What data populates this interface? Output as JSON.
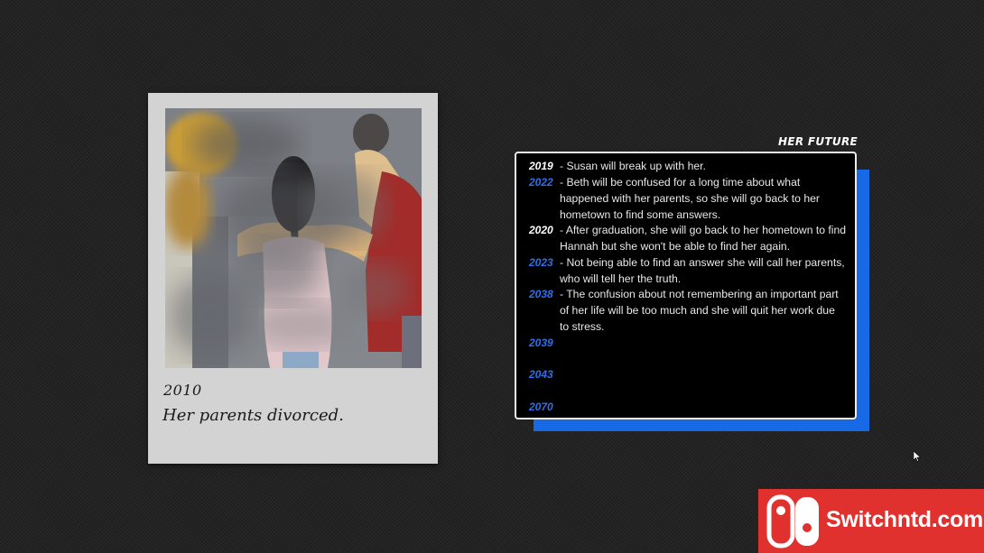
{
  "polaroid": {
    "year": "2010",
    "caption": "Her parents divorced."
  },
  "future": {
    "title": "HER FUTURE",
    "entries": [
      {
        "year": "2019",
        "year_color": "white",
        "text": "- Susan will break up with her."
      },
      {
        "year": "2022",
        "year_color": "blue",
        "text": "- Beth will be confused for a long time about what happened with her parents, so she will go back to her hometown to find some answers."
      },
      {
        "year": "2020",
        "year_color": "white",
        "text": "- After graduation, she will go back to her hometown to find Hannah but she won't be able to find her again."
      },
      {
        "year": "2023",
        "year_color": "blue",
        "text": "- Not being able to find an answer she will call her parents, who will tell her the truth."
      },
      {
        "year": "2038",
        "year_color": "blue",
        "text": "- The confusion about not remembering an important part of her life will be too much and she will quit her work due to stress."
      },
      {
        "year": "2039",
        "year_color": "blue",
        "text": ""
      },
      {
        "year": "2043",
        "year_color": "blue",
        "text": ""
      },
      {
        "year": "2070",
        "year_color": "blue",
        "text": ""
      }
    ]
  },
  "colors": {
    "background": "#232323",
    "accent_blue": "#1769e6",
    "year_blue": "#2f6ee8",
    "polaroid_frame": "#d3d3d3",
    "watermark_red": "#e0312e"
  },
  "watermark": {
    "text": "Switchntd.com",
    "icon": "nintendo-switch-logo-icon"
  },
  "cursor": {
    "icon": "mouse-pointer-icon"
  }
}
